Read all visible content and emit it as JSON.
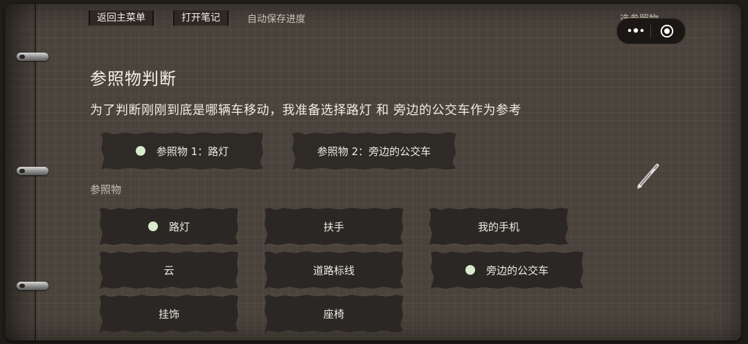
{
  "header": {
    "back_label": "返回主菜单",
    "notes_label": "打开笔记",
    "autosave_label": "自动保存进度",
    "page_tag": "选参照物"
  },
  "capsule": {
    "more_icon": "more-dots-icon",
    "target_icon": "target-icon"
  },
  "main": {
    "title": "参照物判断",
    "description": "为了判断刚刚到底是哪辆车移动，我准备选择路灯 和 旁边的公交车作为参考"
  },
  "selection": [
    {
      "label": "参照物 1：路灯",
      "filled": true
    },
    {
      "label": "参照物 2：旁边的公交车",
      "filled": false
    }
  ],
  "options_section": {
    "label": "参照物",
    "options": [
      {
        "label": "路灯",
        "selected": true
      },
      {
        "label": "扶手",
        "selected": false
      },
      {
        "label": "我的手机",
        "selected": false
      },
      {
        "label": "云",
        "selected": false
      },
      {
        "label": "道路标线",
        "selected": false
      },
      {
        "label": "旁边的公交车",
        "selected": true
      },
      {
        "label": "挂饰",
        "selected": false
      },
      {
        "label": "座椅",
        "selected": false
      }
    ]
  },
  "colors": {
    "selected_dot": "#d8ebcd",
    "card_bg": "#2b2724",
    "page_bg": "#4a433c"
  }
}
